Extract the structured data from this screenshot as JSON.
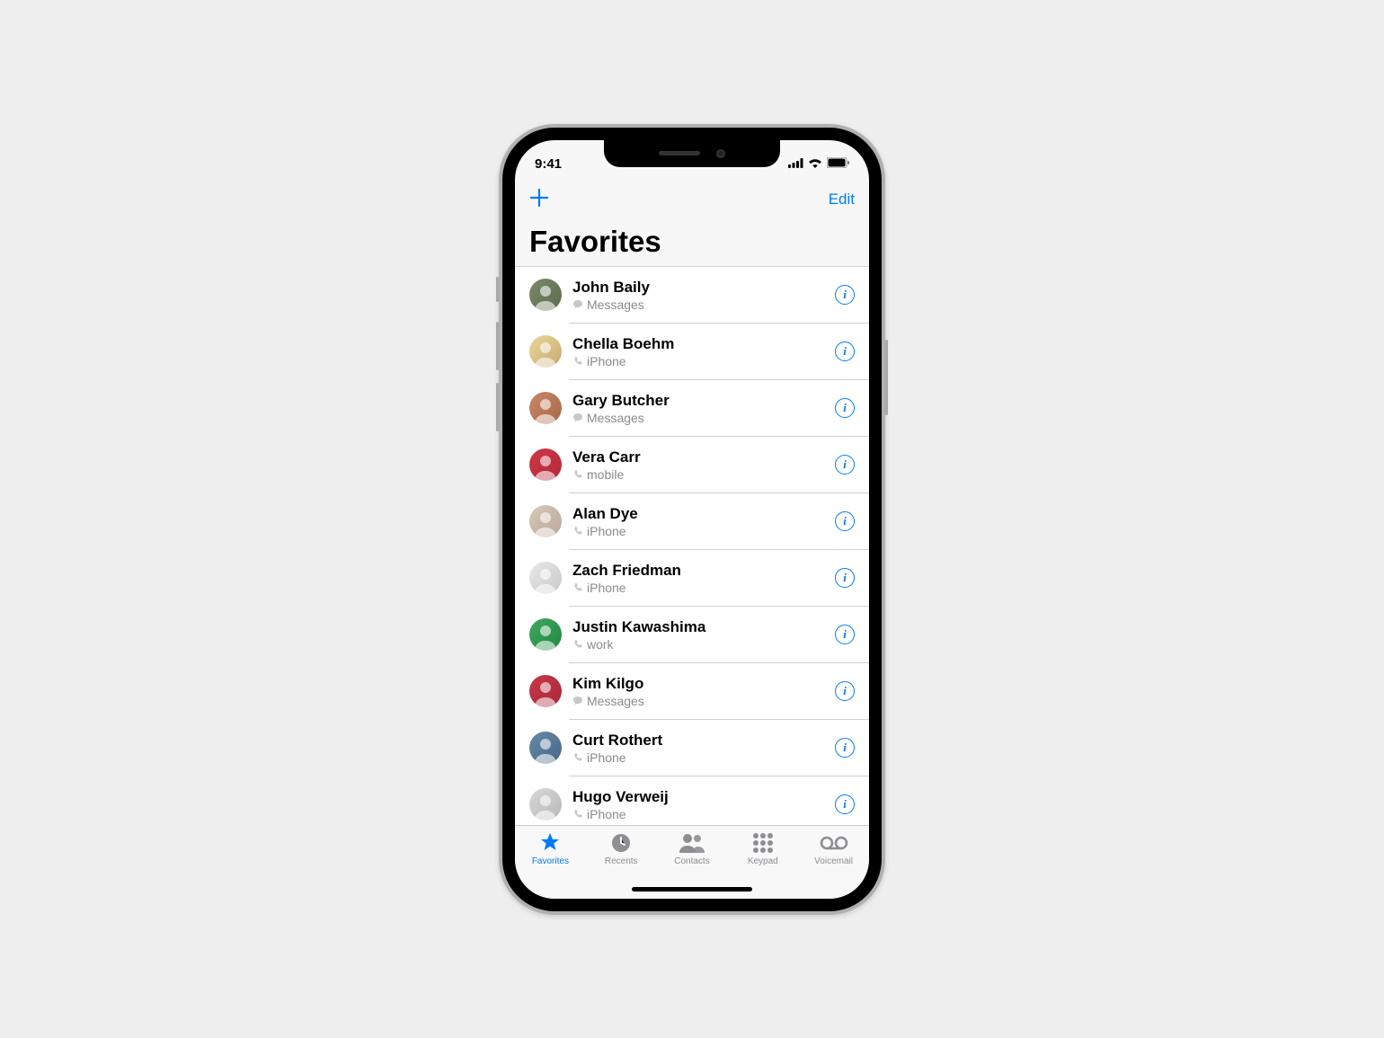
{
  "status": {
    "time": "9:41"
  },
  "nav": {
    "edit": "Edit",
    "title": "Favorites"
  },
  "favorites": [
    {
      "name": "John Baily",
      "sub": "Messages",
      "sub_kind": "message",
      "avatar_bg": "linear-gradient(135deg,#7a8a6a,#5a6a4a)"
    },
    {
      "name": "Chella Boehm",
      "sub": "iPhone",
      "sub_kind": "phone",
      "avatar_bg": "linear-gradient(135deg,#e8d89a,#c8a870)"
    },
    {
      "name": "Gary Butcher",
      "sub": "Messages",
      "sub_kind": "message",
      "avatar_bg": "linear-gradient(135deg,#c88868,#a86848)"
    },
    {
      "name": "Vera Carr",
      "sub": "mobile",
      "sub_kind": "phone",
      "avatar_bg": "linear-gradient(135deg,#d03848,#b02838)"
    },
    {
      "name": "Alan Dye",
      "sub": "iPhone",
      "sub_kind": "phone",
      "avatar_bg": "linear-gradient(135deg,#d8c8b8,#b8a898)"
    },
    {
      "name": "Zach Friedman",
      "sub": "iPhone",
      "sub_kind": "phone",
      "avatar_bg": "linear-gradient(135deg,#e8e8e8,#c8c8c8)"
    },
    {
      "name": "Justin Kawashima",
      "sub": "work",
      "sub_kind": "phone",
      "avatar_bg": "linear-gradient(135deg,#40a860,#208840)"
    },
    {
      "name": "Kim Kilgo",
      "sub": "Messages",
      "sub_kind": "message",
      "avatar_bg": "linear-gradient(135deg,#c83848,#a82838)"
    },
    {
      "name": "Curt Rothert",
      "sub": "iPhone",
      "sub_kind": "phone",
      "avatar_bg": "linear-gradient(135deg,#6888a8,#486888)"
    },
    {
      "name": "Hugo Verweij",
      "sub": "iPhone",
      "sub_kind": "phone",
      "avatar_bg": "linear-gradient(135deg,#d8d8d8,#b8b8b8)"
    }
  ],
  "tabs": [
    {
      "label": "Favorites",
      "icon": "star",
      "active": true
    },
    {
      "label": "Recents",
      "icon": "clock",
      "active": false
    },
    {
      "label": "Contacts",
      "icon": "person",
      "active": false
    },
    {
      "label": "Keypad",
      "icon": "keypad",
      "active": false
    },
    {
      "label": "Voicemail",
      "icon": "voicemail",
      "active": false
    }
  ]
}
